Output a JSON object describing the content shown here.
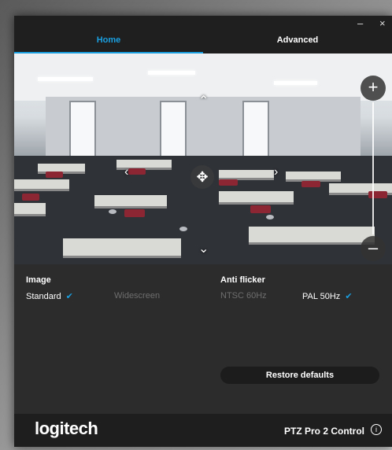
{
  "window": {
    "minimize_label": "–",
    "close_label": "×"
  },
  "tabs": [
    {
      "label": "Home",
      "active": true
    },
    {
      "label": "Advanced",
      "active": false
    }
  ],
  "colors": {
    "accent": "#1a9fe0",
    "background": "#222222",
    "panel": "#2c2c2c"
  },
  "camera": {
    "pan_up_icon": "chevron-up",
    "pan_down_icon": "chevron-down",
    "pan_left_icon": "chevron-left",
    "pan_right_icon": "chevron-right",
    "center_icon": "center-crosshair",
    "zoom_in_label": "+",
    "zoom_out_label": "–"
  },
  "image": {
    "title": "Image",
    "options": [
      {
        "label": "Standard",
        "selected": true
      },
      {
        "label": "Widescreen",
        "selected": false
      }
    ]
  },
  "anti_flicker": {
    "title": "Anti flicker",
    "options": [
      {
        "label": "NTSC 60Hz",
        "selected": false
      },
      {
        "label": "PAL 50Hz",
        "selected": true
      }
    ]
  },
  "restore_label": "Restore defaults",
  "footer": {
    "logo": "logitech",
    "product": "PTZ Pro 2 Control"
  }
}
